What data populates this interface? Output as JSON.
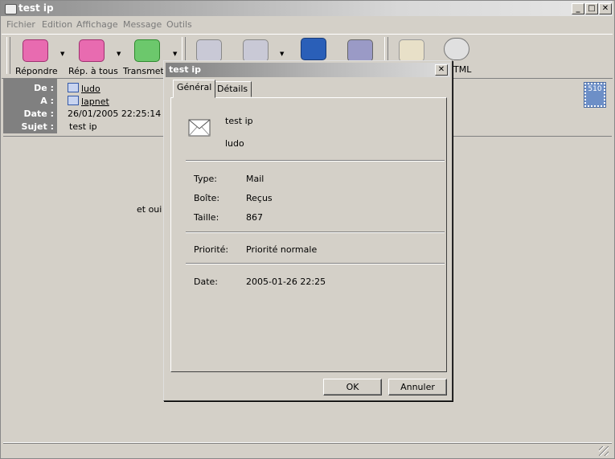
{
  "window": {
    "title": "test ip",
    "minimize": "_",
    "maximize": "□",
    "close": "✕"
  },
  "menu": [
    "Fichier",
    "Edition",
    "Affichage",
    "Message",
    "Outils"
  ],
  "toolbar": {
    "reply": "Répondre",
    "reply_all": "Rép. à tous",
    "forward": "Transmett",
    "html_partial": "TML"
  },
  "headers": {
    "from_label": "De :",
    "from_value": "ludo",
    "to_label": "A :",
    "to_value": "lapnet",
    "date_label": "Date :",
    "date_value": "26/01/2005 22:25:14",
    "subject_label": "Sujet :",
    "subject_value": "test ip"
  },
  "stamp": "510",
  "body_text_partial": "et oui c",
  "dialog": {
    "title": "test ip",
    "close": "✕",
    "tabs": [
      "Général",
      "Détails"
    ],
    "active_tab": "Général",
    "subject": "test ip",
    "sender": "ludo",
    "type_label": "Type:",
    "type_value": "Mail",
    "box_label": "Boîte:",
    "box_value": "Reçus",
    "size_label": "Taille:",
    "size_value": "867",
    "priority_label": "Priorité:",
    "priority_value": "Priorité normale",
    "date_label": "Date:",
    "date_value": "2005-01-26 22:25",
    "ok": "OK",
    "cancel": "Annuler"
  },
  "icons": {
    "app": "mail-app-icon",
    "envelope": "envelope-icon",
    "contact": "contact-card-icon"
  }
}
